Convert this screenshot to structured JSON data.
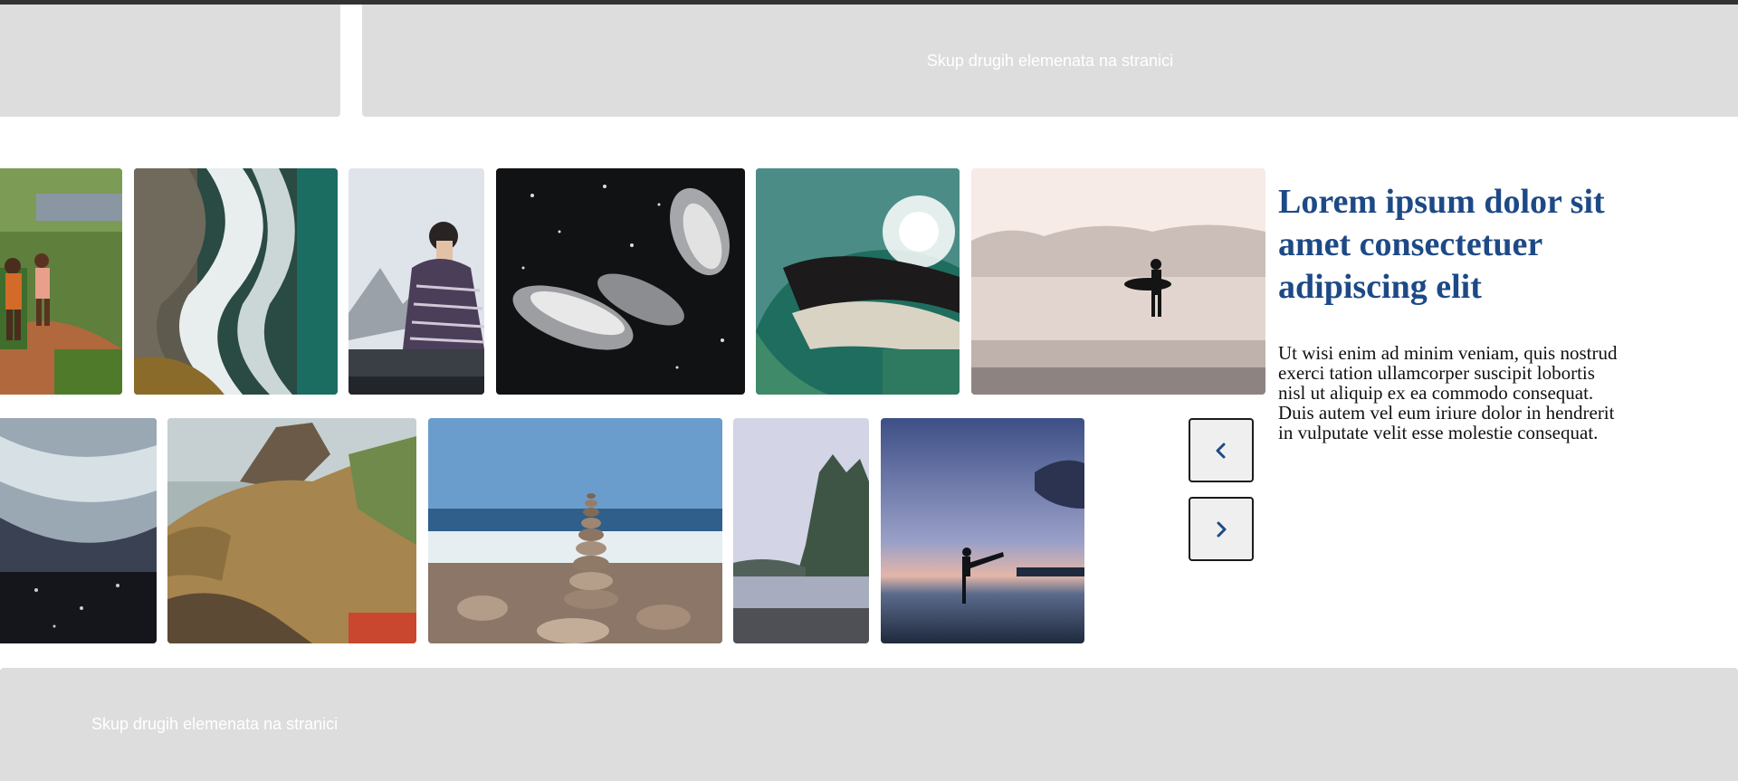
{
  "placeholders": {
    "top_left_text": "",
    "top_right_text": "Skup drugih elemenata na stranici",
    "bottom_text": "Skup drugih elemenata na stranici"
  },
  "gallery": {
    "row1": [
      {
        "subject": "children running on jungle path"
      },
      {
        "subject": "wave breaking on shore aerial"
      },
      {
        "subject": "woman in blanket on car roof"
      },
      {
        "subject": "penguins swimming underwater"
      },
      {
        "subject": "barrel wave with sun"
      },
      {
        "subject": "surfer walking on misty beach"
      }
    ],
    "row2": [
      {
        "subject": "foamy ocean water texture"
      },
      {
        "subject": "coastal cliffs"
      },
      {
        "subject": "stacked stones on pebble beach"
      },
      {
        "subject": "misty island with trees"
      },
      {
        "subject": "silhouette kicking on beach at dusk"
      }
    ]
  },
  "navigation": {
    "prev_icon": "chevron-left-icon",
    "next_icon": "chevron-right-icon"
  },
  "content": {
    "heading": "Lorem ipsum dolor sit amet consectetuer adipiscing elit",
    "body": "Ut wisi enim ad minim veniam, quis nostrud exerci tation ullamcorper suscipit lobortis nisl ut aliquip ex ea commodo consequat. Duis autem vel eum iriure dolor in hendrerit in vulputate velit esse molestie consequat."
  },
  "colors": {
    "heading": "#1d4a86",
    "placeholder_bg": "#dddddd",
    "topbar": "#333333",
    "chevron": "#1d4a86"
  }
}
